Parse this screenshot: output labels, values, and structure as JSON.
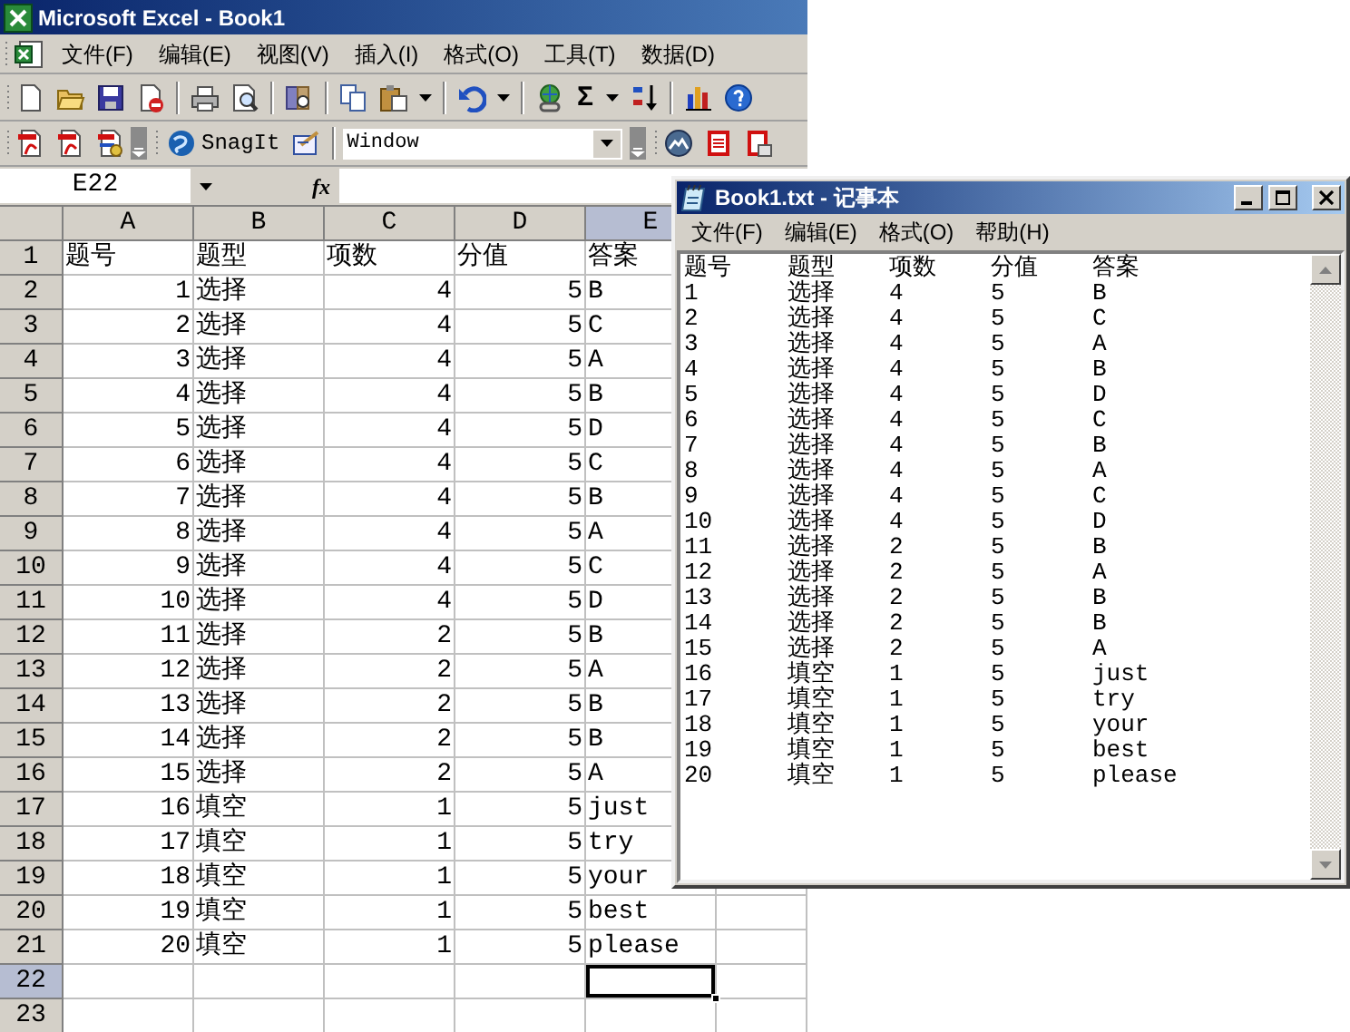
{
  "excel": {
    "title": "Microsoft Excel - Book1",
    "menu": [
      "文件(F)",
      "编辑(E)",
      "视图(V)",
      "插入(I)",
      "格式(O)",
      "工具(T)",
      "数据(D)"
    ],
    "sum_symbol": "Σ",
    "snagit_button": "SnagIt",
    "window_combo": "Window",
    "name_box": "E22",
    "formula_label": "fx",
    "columns": [
      {
        "label": "A",
        "selected": false
      },
      {
        "label": "B",
        "selected": false
      },
      {
        "label": "C",
        "selected": false
      },
      {
        "label": "D",
        "selected": false
      },
      {
        "label": "E",
        "selected": true
      }
    ],
    "rows": [
      {
        "label": "1",
        "selected": false,
        "cells": [
          "题号",
          "题型",
          "项数",
          "分值",
          "答案"
        ]
      },
      {
        "label": "2",
        "selected": false,
        "cells": [
          "1",
          "选择",
          "4",
          "5",
          "B"
        ]
      },
      {
        "label": "3",
        "selected": false,
        "cells": [
          "2",
          "选择",
          "4",
          "5",
          "C"
        ]
      },
      {
        "label": "4",
        "selected": false,
        "cells": [
          "3",
          "选择",
          "4",
          "5",
          "A"
        ]
      },
      {
        "label": "5",
        "selected": false,
        "cells": [
          "4",
          "选择",
          "4",
          "5",
          "B"
        ]
      },
      {
        "label": "6",
        "selected": false,
        "cells": [
          "5",
          "选择",
          "4",
          "5",
          "D"
        ]
      },
      {
        "label": "7",
        "selected": false,
        "cells": [
          "6",
          "选择",
          "4",
          "5",
          "C"
        ]
      },
      {
        "label": "8",
        "selected": false,
        "cells": [
          "7",
          "选择",
          "4",
          "5",
          "B"
        ]
      },
      {
        "label": "9",
        "selected": false,
        "cells": [
          "8",
          "选择",
          "4",
          "5",
          "A"
        ]
      },
      {
        "label": "10",
        "selected": false,
        "cells": [
          "9",
          "选择",
          "4",
          "5",
          "C"
        ]
      },
      {
        "label": "11",
        "selected": false,
        "cells": [
          "10",
          "选择",
          "4",
          "5",
          "D"
        ]
      },
      {
        "label": "12",
        "selected": false,
        "cells": [
          "11",
          "选择",
          "2",
          "5",
          "B"
        ]
      },
      {
        "label": "13",
        "selected": false,
        "cells": [
          "12",
          "选择",
          "2",
          "5",
          "A"
        ]
      },
      {
        "label": "14",
        "selected": false,
        "cells": [
          "13",
          "选择",
          "2",
          "5",
          "B"
        ]
      },
      {
        "label": "15",
        "selected": false,
        "cells": [
          "14",
          "选择",
          "2",
          "5",
          "B"
        ]
      },
      {
        "label": "16",
        "selected": false,
        "cells": [
          "15",
          "选择",
          "2",
          "5",
          "A"
        ]
      },
      {
        "label": "17",
        "selected": false,
        "cells": [
          "16",
          "填空",
          "1",
          "5",
          "just"
        ]
      },
      {
        "label": "18",
        "selected": false,
        "cells": [
          "17",
          "填空",
          "1",
          "5",
          "try"
        ]
      },
      {
        "label": "19",
        "selected": false,
        "cells": [
          "18",
          "填空",
          "1",
          "5",
          "your"
        ]
      },
      {
        "label": "20",
        "selected": false,
        "cells": [
          "19",
          "填空",
          "1",
          "5",
          "best"
        ]
      },
      {
        "label": "21",
        "selected": false,
        "cells": [
          "20",
          "填空",
          "1",
          "5",
          "please"
        ]
      },
      {
        "label": "22",
        "selected": true
      },
      {
        "label": "23",
        "selected": false
      }
    ]
  },
  "notepad": {
    "title": "Book1.txt - 记事本",
    "menu": [
      "文件(F)",
      "编辑(E)",
      "格式(O)",
      "帮助(H)"
    ],
    "lines": [
      [
        "题号",
        "题型",
        "项数",
        "分值",
        "答案"
      ],
      [
        "1",
        "选择",
        "4",
        "5",
        "B"
      ],
      [
        "2",
        "选择",
        "4",
        "5",
        "C"
      ],
      [
        "3",
        "选择",
        "4",
        "5",
        "A"
      ],
      [
        "4",
        "选择",
        "4",
        "5",
        "B"
      ],
      [
        "5",
        "选择",
        "4",
        "5",
        "D"
      ],
      [
        "6",
        "选择",
        "4",
        "5",
        "C"
      ],
      [
        "7",
        "选择",
        "4",
        "5",
        "B"
      ],
      [
        "8",
        "选择",
        "4",
        "5",
        "A"
      ],
      [
        "9",
        "选择",
        "4",
        "5",
        "C"
      ],
      [
        "10",
        "选择",
        "4",
        "5",
        "D"
      ],
      [
        "11",
        "选择",
        "2",
        "5",
        "B"
      ],
      [
        "12",
        "选择",
        "2",
        "5",
        "A"
      ],
      [
        "13",
        "选择",
        "2",
        "5",
        "B"
      ],
      [
        "14",
        "选择",
        "2",
        "5",
        "B"
      ],
      [
        "15",
        "选择",
        "2",
        "5",
        "A"
      ],
      [
        "16",
        "填空",
        "1",
        "5",
        "just"
      ],
      [
        "17",
        "填空",
        "1",
        "5",
        "try"
      ],
      [
        "18",
        "填空",
        "1",
        "5",
        "your"
      ],
      [
        "19",
        "填空",
        "1",
        "5",
        "best"
      ],
      [
        "20",
        "填空",
        "1",
        "5",
        "please"
      ]
    ]
  }
}
